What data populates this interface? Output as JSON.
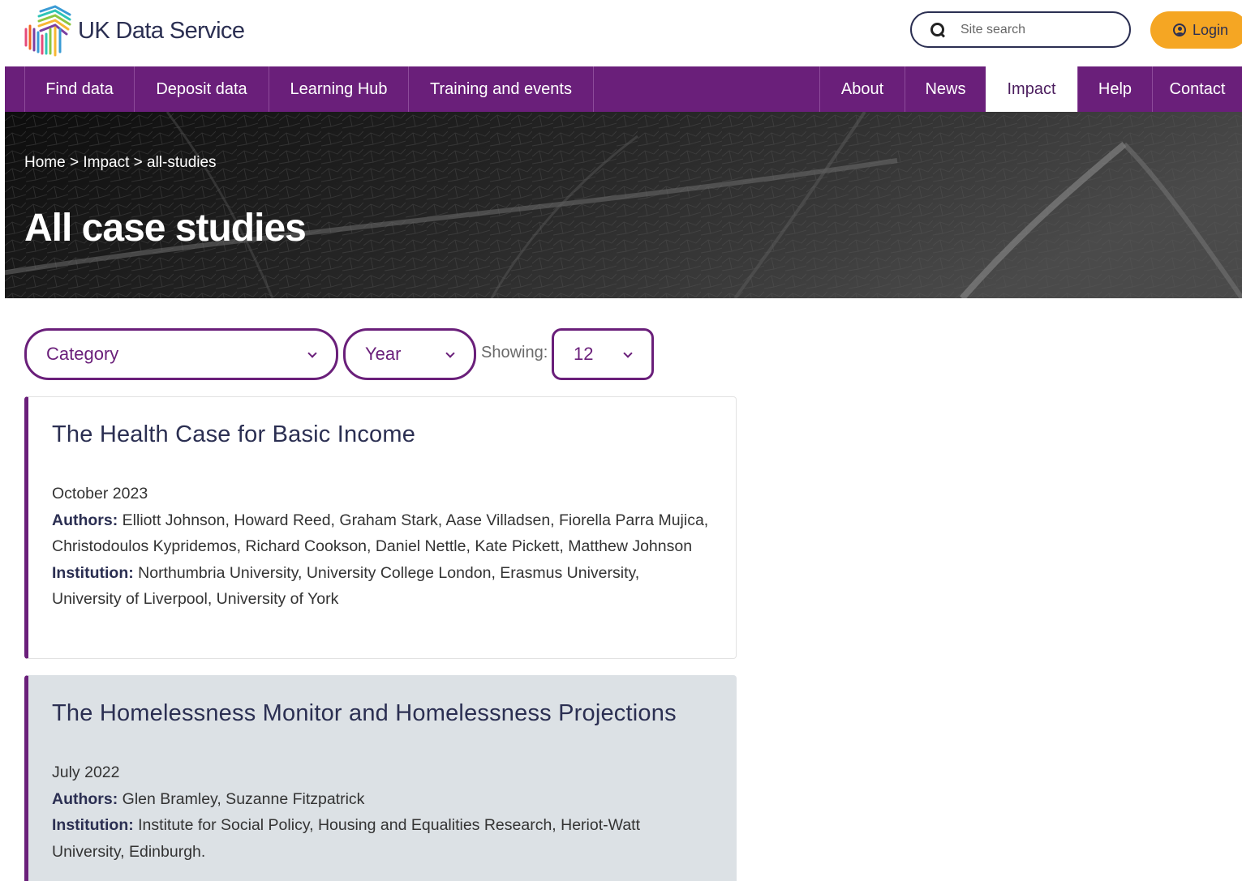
{
  "header": {
    "logo_text": "UK Data Service",
    "search_placeholder": "Site search",
    "login_label": "Login"
  },
  "nav": {
    "left": [
      "Find data",
      "Deposit data",
      "Learning Hub",
      "Training and events"
    ],
    "right": [
      "About",
      "News",
      "Impact",
      "Help",
      "Contact"
    ],
    "active": "Impact"
  },
  "hero": {
    "breadcrumb": "Home > Impact > all-studies",
    "title": "All case studies"
  },
  "filters": {
    "category_label": "Category",
    "year_label": "Year",
    "showing_label": "Showing:",
    "showing_value": "12"
  },
  "labels": {
    "authors": "Authors:",
    "institution": "Institution:"
  },
  "studies": [
    {
      "title": "The Health Case for Basic Income",
      "date": "October 2023",
      "authors": "Elliott Johnson, Howard Reed, Graham Stark, Aase Villadsen, Fiorella Parra Mujica, Christodoulos Kypridemos, Richard Cookson, Daniel Nettle, Kate Pickett, Matthew Johnson",
      "institution": "Northumbria University, University College London, Erasmus University, University of Liverpool, University of York"
    },
    {
      "title": "The Homelessness Monitor and Homelessness Projections",
      "date": "July 2022",
      "authors": "Glen Bramley, Suzanne Fitzpatrick",
      "institution": "Institute for Social Policy, Housing and Equalities Research, Heriot-Watt University, Edinburgh."
    }
  ],
  "colors": {
    "brand_purple": "#6a1f7a",
    "navy": "#2b2f52",
    "login_orange": "#f5a623",
    "card_grey": "#dce1e5"
  }
}
